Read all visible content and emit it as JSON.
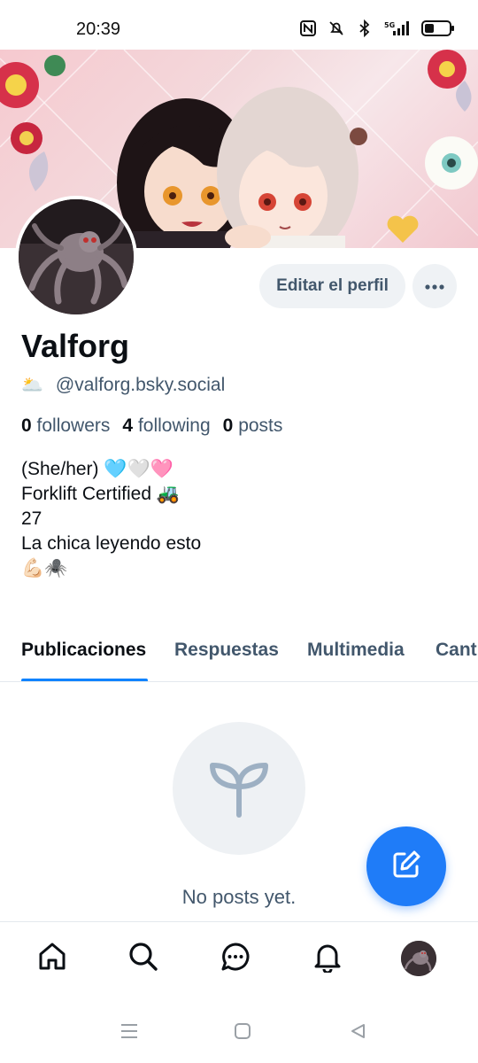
{
  "status_bar": {
    "time": "20:39",
    "network_label": "5G",
    "battery_level_pct": 40
  },
  "profile": {
    "display_name": "Valforg",
    "handle_emoji": "🌥️",
    "handle": "@valforg.bsky.social",
    "followers_count": "0",
    "followers_label": "followers",
    "following_count": "4",
    "following_label": "following",
    "posts_count": "0",
    "posts_label": "posts",
    "bio_lines": [
      "(She/her) 🩵🤍🩷",
      "Forklift Certified 🚜",
      "27",
      "La chica leyendo esto",
      "💪🏻🕷️"
    ]
  },
  "actions": {
    "edit_label": "Editar el perfil",
    "more_icon": "ellipsis-icon"
  },
  "tabs": [
    {
      "label": "Publicaciones",
      "active": true
    },
    {
      "label": "Respuestas",
      "active": false
    },
    {
      "label": "Multimedia",
      "active": false
    },
    {
      "label": "Cant",
      "active": false
    }
  ],
  "empty_state": {
    "icon": "sprout-icon",
    "text": "No posts yet."
  },
  "fab": {
    "icon": "compose-icon"
  },
  "bottom_nav": [
    "home-icon",
    "search-icon",
    "chat-icon",
    "bell-icon",
    "profile-avatar"
  ],
  "system_nav": [
    "menu-icon",
    "home-square-icon",
    "back-icon"
  ],
  "colors": {
    "accent": "#1083fe",
    "fab": "#1f7cf8",
    "muted_text": "#42576c",
    "button_bg": "#eff2f5",
    "banner_pink": "#f6c9cf"
  }
}
